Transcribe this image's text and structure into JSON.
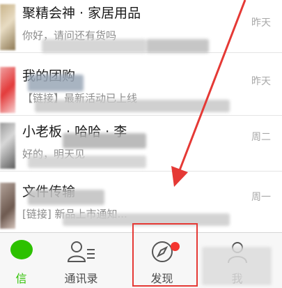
{
  "chats": [
    {
      "title": "聚精会神 · 家居用品",
      "preview": "你好，请问还有货吗",
      "time": "昨天"
    },
    {
      "title": "我的团购",
      "preview": "【链接】最新活动已上线",
      "time": "昨天"
    },
    {
      "title": "小老板 · 哈哈 · 李",
      "preview": "好的，明天见",
      "time": "周二"
    },
    {
      "title": "文件传输",
      "preview": "[链接] 新品上市通知...",
      "time": "周一"
    }
  ],
  "tabbar": {
    "chats_label": "信",
    "contacts_label": "通讯录",
    "discover_label": "发现",
    "me_label": "我"
  },
  "colors": {
    "accent": "#2dc100",
    "highlight": "#e53935",
    "badge": "#f43530"
  },
  "icons": {
    "chats": "chat-bubble-icon",
    "contacts": "contacts-icon",
    "discover": "compass-icon",
    "me": "person-icon"
  }
}
